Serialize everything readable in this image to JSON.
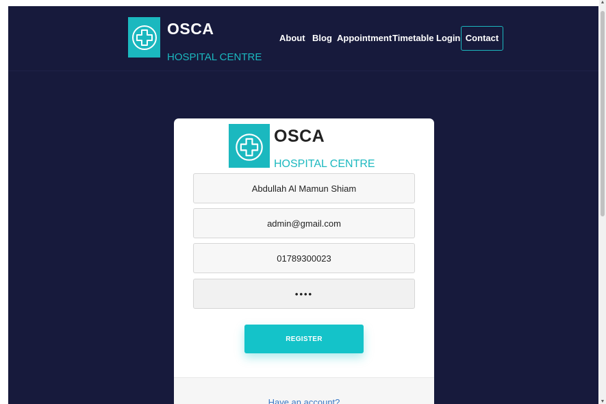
{
  "brand": {
    "title": "OSCA",
    "subtitle": "HOSPITAL CENTRE",
    "icon": "plus-cross-icon",
    "accent_color": "#1bb8bf"
  },
  "nav": {
    "items": [
      {
        "label": "About"
      },
      {
        "label": "Blog"
      },
      {
        "label": "Appointment"
      },
      {
        "label": "Timetable"
      },
      {
        "label": "Login"
      }
    ],
    "contact_label": "Contact"
  },
  "form": {
    "brand_title": "OSCA",
    "brand_subtitle": "HOSPITAL CENTRE",
    "name_value": "Abdullah Al Mamun Shiam",
    "email_value": "admin@gmail.com",
    "phone_value": "01789300023",
    "password_value": "••••",
    "register_label": "REGISTER",
    "have_account_label": "Have an account?"
  },
  "colors": {
    "background": "#171a3c",
    "button": "#14c3c9",
    "link": "#3a78c5"
  }
}
